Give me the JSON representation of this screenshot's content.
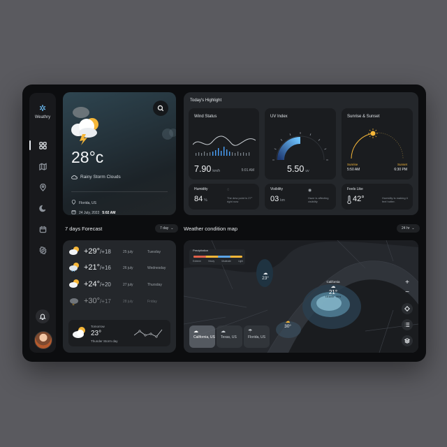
{
  "app": {
    "name": "Weathry"
  },
  "current": {
    "temp": "28°c",
    "condition": "Rainy Storm Clouds",
    "location": "Florida, US",
    "date_prefix": "24 July, 2022",
    "time": "5:02 AM"
  },
  "highlight": {
    "title": "Today's Highlight",
    "wind": {
      "label": "Wind Status",
      "value": "7.90",
      "unit": "km/h",
      "time": "5:01 AM"
    },
    "uv": {
      "label": "UV Index",
      "value": "5.50",
      "unit": "uv",
      "fraction": 0.55
    },
    "sun": {
      "label": "Sunrise & Sunset",
      "sunrise_label": "Sunrise",
      "sunrise_time": "5:50 AM",
      "sunset_label": "Sunset",
      "sunset_time": "6:30 PM"
    },
    "humidity": {
      "label": "Humidity",
      "value": "84",
      "unit": "%",
      "note": "The dew point is 27° right now"
    },
    "visibility": {
      "label": "Visibility",
      "value": "03",
      "unit": "km",
      "note": "Haze is affecting visibility"
    },
    "feels": {
      "label": "Feels Like",
      "value": "42°",
      "note": "Humidity is making it feel hotter."
    }
  },
  "forecast": {
    "title": "7 days Forecast",
    "range": "7 day",
    "rows": [
      {
        "temp": "+29°",
        "low": "/+18",
        "date": "25 july",
        "day": "Tuesday"
      },
      {
        "temp": "+21°",
        "low": "/+16",
        "date": "26 july",
        "day": "Wednesday"
      },
      {
        "temp": "+24°",
        "low": "/+20",
        "date": "27 july",
        "day": "Thursday"
      },
      {
        "temp": "+30°",
        "low": "/+17",
        "date": "28 july",
        "day": "Friday"
      }
    ],
    "tomorrow": {
      "label": "Tomorrow",
      "temp": "23°",
      "condition": "Thunder Storm day"
    }
  },
  "map": {
    "title": "Weather condition map",
    "range": "24 hr",
    "legend": {
      "title": "Precipitation",
      "levels": [
        "Extreme",
        "Heavy",
        "Moderate",
        "Light"
      ]
    },
    "markers": [
      {
        "temp": "23°"
      },
      {
        "city": "California",
        "temp": "21°",
        "wind": "18 km/h",
        "rain": "90%"
      },
      {
        "temp": "30°"
      }
    ],
    "chips": [
      {
        "name": "California, US"
      },
      {
        "name": "Texas, US"
      },
      {
        "name": "Florida, US"
      }
    ]
  },
  "colors": {
    "accent": "#4aa3ff",
    "sun": "#f5b638",
    "background": "#0c0d0f"
  }
}
